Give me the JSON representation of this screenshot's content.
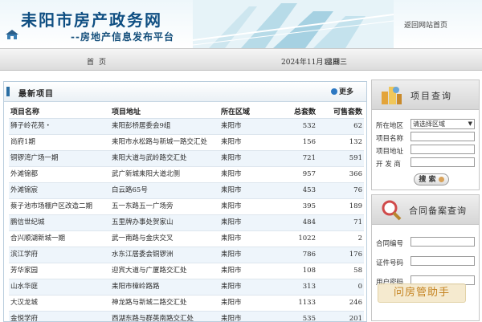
{
  "header": {
    "title": "耒阳市房产政务网",
    "subtitle": "--房地产信息发布平台",
    "return_link": "返回网站首页"
  },
  "nav": {
    "home": "首页",
    "date": "2024年11月13日",
    "weekday": "星期三"
  },
  "projects": {
    "title": "最新项目",
    "more": "更多",
    "columns": [
      "项目名称",
      "项目地址",
      "所在区域",
      "总套数",
      "可售套数"
    ],
    "rows": [
      {
        "name": "狮子岭花苑・",
        "address": "耒阳彭桥居委会9组",
        "area": "耒阳市",
        "total": "532",
        "available": "62"
      },
      {
        "name": "尚府1期",
        "address": "耒阳市水松路与新城一路交汇处",
        "area": "耒阳市",
        "total": "156",
        "available": "132"
      },
      {
        "name": "铜锣湾广场一期",
        "address": "耒阳大道与武岭路交汇处",
        "area": "耒阳市",
        "total": "721",
        "available": "591"
      },
      {
        "name": "外滩锦都",
        "address": "武广新城耒阳大道北侧",
        "area": "耒阳市",
        "total": "957",
        "available": "366"
      },
      {
        "name": "外滩锦宸",
        "address": "白云路65号",
        "area": "耒阳市",
        "total": "453",
        "available": "76"
      },
      {
        "name": "蔡子池市场棚户区改造二期",
        "address": "五一东路五一广场旁",
        "area": "耒阳市",
        "total": "395",
        "available": "189"
      },
      {
        "name": "鹏信世纪城",
        "address": "五里牌办事处贺家山",
        "area": "耒阳市",
        "total": "484",
        "available": "71"
      },
      {
        "name": "合兴顺湖新城一期",
        "address": "武一南路与金庆交叉",
        "area": "耒阳市",
        "total": "1022",
        "available": "2"
      },
      {
        "name": "滨江学府",
        "address": "水东江居委会铜锣洲",
        "area": "耒阳市",
        "total": "786",
        "available": "176"
      },
      {
        "name": "芳华家园",
        "address": "迎宾大道与广厦路交汇处",
        "area": "耒阳市",
        "total": "108",
        "available": "58"
      },
      {
        "name": "山水华庭",
        "address": "耒阳市樟岭路路",
        "area": "耒阳市",
        "total": "313",
        "available": "0"
      },
      {
        "name": "大汉龙城",
        "address": "神龙路与新城二路交汇处",
        "area": "耒阳市",
        "total": "1133",
        "available": "246"
      },
      {
        "name": "金悦学府",
        "address": "西湖东路与群英南路交汇处",
        "area": "耒阳市",
        "total": "535",
        "available": "201"
      }
    ]
  },
  "project_query": {
    "title": "项目查询",
    "region_label": "所在地区",
    "region_value": "请选择区域",
    "name_label": "项目名称",
    "address_label": "项目地址",
    "developer_label": "开 发 商",
    "search_label": "搜 索"
  },
  "contract_query": {
    "title": "合同备案查询",
    "contract_no_label": "合同编号",
    "cert_no_label": "证件号码",
    "password_label": "用户密码"
  },
  "watermark": "问房管助手"
}
